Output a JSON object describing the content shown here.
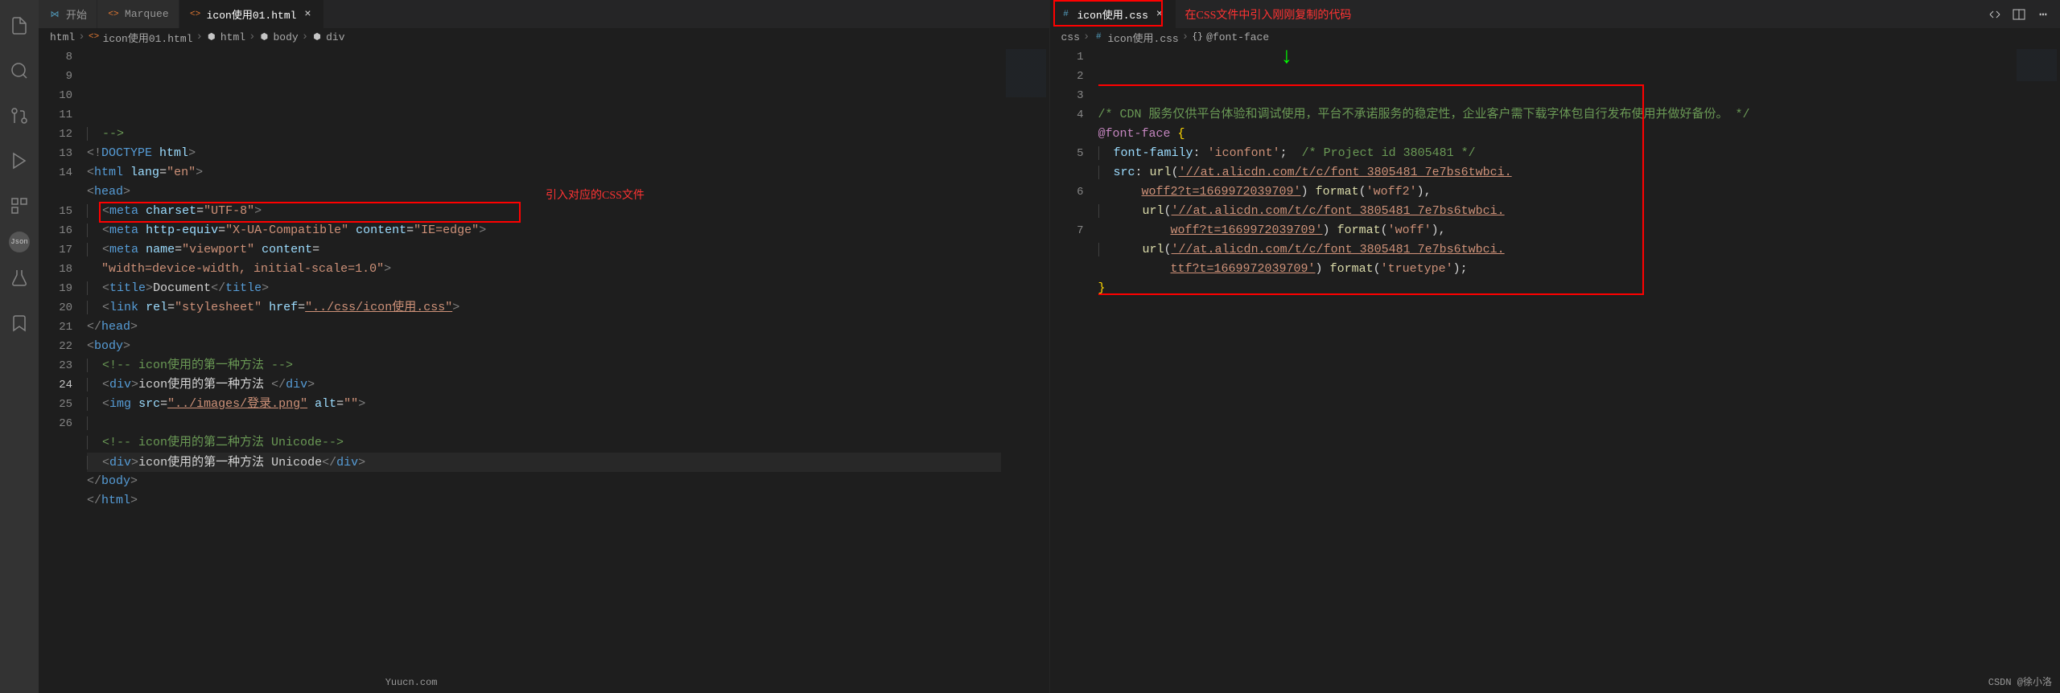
{
  "activityBar": {
    "icons": [
      "files",
      "search",
      "source-control",
      "debug",
      "extensions",
      "json",
      "account",
      "bookmark"
    ]
  },
  "leftEditor": {
    "tabs": [
      {
        "label": "开始",
        "icon": "vs",
        "active": false
      },
      {
        "label": "Marquee",
        "icon": "html",
        "active": false
      },
      {
        "label": "icon使用01.html",
        "icon": "html",
        "active": true
      }
    ],
    "breadcrumbs": [
      {
        "label": "html",
        "icon": ""
      },
      {
        "label": "icon使用01.html",
        "icon": "html"
      },
      {
        "label": "html",
        "icon": "tag"
      },
      {
        "label": "body",
        "icon": "tag"
      },
      {
        "label": "div",
        "icon": "tag"
      }
    ],
    "gutterStart": 8,
    "currentLine": 24,
    "annotation": "引入对应的CSS文件",
    "lines": [
      {
        "indent": 1,
        "tokens": [
          [
            "comment",
            "-->"
          ]
        ]
      },
      {
        "indent": 0,
        "tokens": [
          [
            "bracket",
            "<!"
          ],
          [
            "tag",
            "DOCTYPE"
          ],
          [
            "text",
            " "
          ],
          [
            "attr",
            "html"
          ],
          [
            "bracket",
            ">"
          ]
        ]
      },
      {
        "indent": 0,
        "tokens": [
          [
            "bracket",
            "<"
          ],
          [
            "tag",
            "html"
          ],
          [
            "text",
            " "
          ],
          [
            "attr",
            "lang"
          ],
          [
            "text",
            "="
          ],
          [
            "string",
            "\"en\""
          ],
          [
            "bracket",
            ">"
          ]
        ]
      },
      {
        "indent": 0,
        "tokens": [
          [
            "bracket",
            "<"
          ],
          [
            "tag",
            "head"
          ],
          [
            "bracket",
            ">"
          ]
        ]
      },
      {
        "indent": 1,
        "tokens": [
          [
            "bracket",
            "<"
          ],
          [
            "tag",
            "meta"
          ],
          [
            "text",
            " "
          ],
          [
            "attr",
            "charset"
          ],
          [
            "text",
            "="
          ],
          [
            "string",
            "\"UTF-8\""
          ],
          [
            "bracket",
            ">"
          ]
        ]
      },
      {
        "indent": 1,
        "tokens": [
          [
            "bracket",
            "<"
          ],
          [
            "tag",
            "meta"
          ],
          [
            "text",
            " "
          ],
          [
            "attr",
            "http-equiv"
          ],
          [
            "text",
            "="
          ],
          [
            "string",
            "\"X-UA-Compatible\""
          ],
          [
            "text",
            " "
          ],
          [
            "attr",
            "content"
          ],
          [
            "text",
            "="
          ],
          [
            "string",
            "\"IE=edge\""
          ],
          [
            "bracket",
            ">"
          ]
        ]
      },
      {
        "indent": 1,
        "tokens": [
          [
            "bracket",
            "<"
          ],
          [
            "tag",
            "meta"
          ],
          [
            "text",
            " "
          ],
          [
            "attr",
            "name"
          ],
          [
            "text",
            "="
          ],
          [
            "string",
            "\"viewport\""
          ],
          [
            "text",
            " "
          ],
          [
            "attr",
            "content"
          ],
          [
            "text",
            "="
          ],
          [
            "string",
            "\"width=device-width, initial-scale=1.0\""
          ],
          [
            "bracket",
            ">"
          ]
        ]
      },
      {
        "indent": 1,
        "tokens": [
          [
            "bracket",
            "<"
          ],
          [
            "tag",
            "title"
          ],
          [
            "bracket",
            ">"
          ],
          [
            "text",
            "Document"
          ],
          [
            "bracket",
            "</"
          ],
          [
            "tag",
            "title"
          ],
          [
            "bracket",
            ">"
          ]
        ]
      },
      {
        "indent": 1,
        "tokens": [
          [
            "bracket",
            "<"
          ],
          [
            "tag",
            "link"
          ],
          [
            "text",
            " "
          ],
          [
            "attr",
            "rel"
          ],
          [
            "text",
            "="
          ],
          [
            "string",
            "\"stylesheet\""
          ],
          [
            "text",
            " "
          ],
          [
            "attr",
            "href"
          ],
          [
            "text",
            "="
          ],
          [
            "string-u",
            "\"../css/icon使用.css\""
          ],
          [
            "bracket",
            ">"
          ]
        ]
      },
      {
        "indent": 0,
        "tokens": [
          [
            "bracket",
            "</"
          ],
          [
            "tag",
            "head"
          ],
          [
            "bracket",
            ">"
          ]
        ]
      },
      {
        "indent": 0,
        "tokens": [
          [
            "bracket",
            "<"
          ],
          [
            "tag",
            "body"
          ],
          [
            "bracket",
            ">"
          ]
        ]
      },
      {
        "indent": 1,
        "tokens": [
          [
            "comment",
            "<!-- icon使用的第一种方法 -->"
          ]
        ]
      },
      {
        "indent": 1,
        "tokens": [
          [
            "bracket",
            "<"
          ],
          [
            "tag",
            "div"
          ],
          [
            "bracket",
            ">"
          ],
          [
            "text",
            "icon使用的第一种方法 "
          ],
          [
            "bracket",
            "</"
          ],
          [
            "tag",
            "div"
          ],
          [
            "bracket",
            ">"
          ]
        ]
      },
      {
        "indent": 1,
        "tokens": [
          [
            "bracket",
            "<"
          ],
          [
            "tag",
            "img"
          ],
          [
            "text",
            " "
          ],
          [
            "attr",
            "src"
          ],
          [
            "text",
            "="
          ],
          [
            "string-u",
            "\"../images/登录.png\""
          ],
          [
            "text",
            " "
          ],
          [
            "attr",
            "alt"
          ],
          [
            "text",
            "="
          ],
          [
            "string",
            "\"\""
          ],
          [
            "bracket",
            ">"
          ]
        ]
      },
      {
        "indent": 1,
        "tokens": []
      },
      {
        "indent": 1,
        "tokens": [
          [
            "comment",
            "<!-- icon使用的第二种方法 Unicode-->"
          ]
        ]
      },
      {
        "indent": 1,
        "tokens": [
          [
            "bracket",
            "<"
          ],
          [
            "tag",
            "div"
          ],
          [
            "bracket",
            ">"
          ],
          [
            "text",
            "icon使用的第一种方法 Unicode"
          ],
          [
            "bracket",
            "</"
          ],
          [
            "tag",
            "div"
          ],
          [
            "bracket",
            ">"
          ]
        ]
      },
      {
        "indent": 0,
        "tokens": [
          [
            "bracket",
            "</"
          ],
          [
            "tag",
            "body"
          ],
          [
            "bracket",
            ">"
          ]
        ]
      },
      {
        "indent": 0,
        "tokens": [
          [
            "bracket",
            "</"
          ],
          [
            "tag",
            "html"
          ],
          [
            "bracket",
            ">"
          ]
        ]
      }
    ]
  },
  "rightEditor": {
    "tabs": [
      {
        "label": "icon使用.css",
        "icon": "css",
        "active": true
      }
    ],
    "breadcrumbs": [
      {
        "label": "css",
        "icon": ""
      },
      {
        "label": "icon使用.css",
        "icon": "css"
      },
      {
        "label": "@font-face",
        "icon": "brace"
      }
    ],
    "annotation": "在CSS文件中引入刚刚复制的代码",
    "gutterStart": 1,
    "lines": [
      {
        "indent": 0,
        "tokens": [
          [
            "comment",
            "/* CDN 服务仅供平台体验和调试使用，平台不承诺服务的稳定性，企业客户需下载字体包自行发布使用并做好备份。 */"
          ]
        ]
      },
      {
        "indent": 0,
        "tokens": [
          [
            "keyword",
            "@font-face"
          ],
          [
            "text",
            " "
          ],
          [
            "brace",
            "{"
          ]
        ]
      },
      {
        "indent": 1,
        "tokens": [
          [
            "property",
            "font-family"
          ],
          [
            "text",
            ": "
          ],
          [
            "string",
            "'iconfont'"
          ],
          [
            "text",
            ";  "
          ],
          [
            "comment",
            "/* Project id 3805481 */"
          ]
        ]
      },
      {
        "indent": 1,
        "tokens": [
          [
            "property",
            "src"
          ],
          [
            "text",
            ": "
          ],
          [
            "func",
            "url"
          ],
          [
            "text",
            "("
          ],
          [
            "string-u",
            "'//at.alicdn.com/t/c/font_3805481_7e7bs6twbci.woff2?t=1669972039709'"
          ],
          [
            "text",
            ") "
          ],
          [
            "func",
            "format"
          ],
          [
            "text",
            "("
          ],
          [
            "string",
            "'woff2'"
          ],
          [
            "text",
            "),"
          ]
        ]
      },
      {
        "indent": 3,
        "tokens": [
          [
            "func",
            "url"
          ],
          [
            "text",
            "("
          ],
          [
            "string-u",
            "'//at.alicdn.com/t/c/font_3805481_7e7bs6twbci.woff?t=1669972039709'"
          ],
          [
            "text",
            ") "
          ],
          [
            "func",
            "format"
          ],
          [
            "text",
            "("
          ],
          [
            "string",
            "'woff'"
          ],
          [
            "text",
            "),"
          ]
        ]
      },
      {
        "indent": 3,
        "tokens": [
          [
            "func",
            "url"
          ],
          [
            "text",
            "("
          ],
          [
            "string-u",
            "'//at.alicdn.com/t/c/font_3805481_7e7bs6twbci.ttf?t=1669972039709'"
          ],
          [
            "text",
            ") "
          ],
          [
            "func",
            "format"
          ],
          [
            "text",
            "("
          ],
          [
            "string",
            "'truetype'"
          ],
          [
            "text",
            ");"
          ]
        ]
      },
      {
        "indent": 0,
        "tokens": [
          [
            "brace",
            "}"
          ]
        ]
      }
    ]
  },
  "watermarks": {
    "left": "Yuucn.com",
    "right": "CSDN @徐小洛"
  }
}
